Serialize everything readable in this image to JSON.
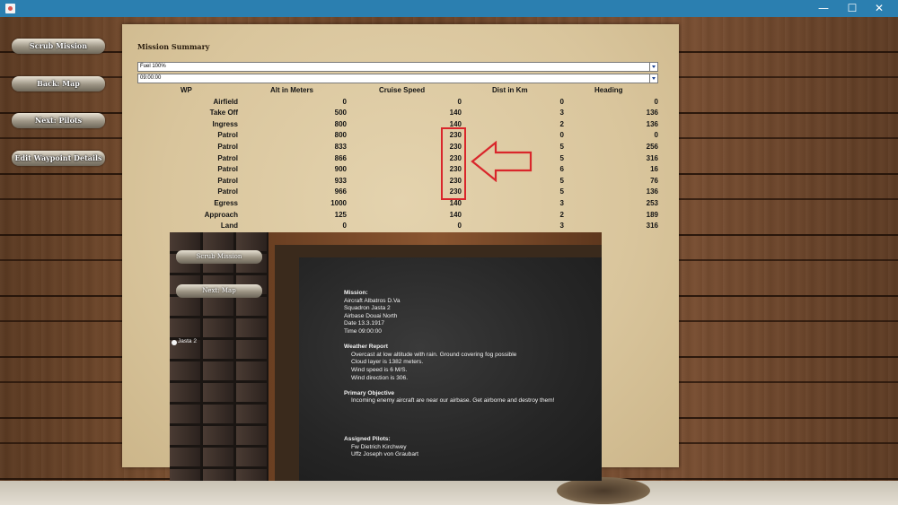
{
  "window": {
    "minimize": "—",
    "maximize": "☐",
    "close": "✕"
  },
  "menu": {
    "scrub_mission": "Scrub Mission",
    "back_map": "Back: Map",
    "next_pilots": "Next: Pilots",
    "edit_waypoint": "Edit Waypoint Details"
  },
  "summary": {
    "title": "Mission Summary",
    "fuel_select": "Fuel 100%",
    "time_select": "09:00:00",
    "columns": [
      "WP",
      "Alt in Meters",
      "Cruise Speed",
      "Dist in Km",
      "Heading"
    ],
    "rows": [
      [
        "Airfield",
        "0",
        "0",
        "0",
        "0"
      ],
      [
        "Take Off",
        "500",
        "140",
        "3",
        "136"
      ],
      [
        "Ingress",
        "800",
        "140",
        "2",
        "136"
      ],
      [
        "Patrol",
        "800",
        "230",
        "0",
        "0"
      ],
      [
        "Patrol",
        "833",
        "230",
        "5",
        "256"
      ],
      [
        "Patrol",
        "866",
        "230",
        "5",
        "316"
      ],
      [
        "Patrol",
        "900",
        "230",
        "6",
        "16"
      ],
      [
        "Patrol",
        "933",
        "230",
        "5",
        "76"
      ],
      [
        "Patrol",
        "966",
        "230",
        "5",
        "136"
      ],
      [
        "Egress",
        "1000",
        "140",
        "3",
        "253"
      ],
      [
        "Approach",
        "125",
        "140",
        "2",
        "189"
      ],
      [
        "Land",
        "0",
        "0",
        "3",
        "316"
      ]
    ]
  },
  "annotation_color": "#d9262b",
  "briefing": {
    "scrub_mission": "Scrub Mission",
    "next_map": "Next: Map",
    "squadron_option": "Jasta 2",
    "lines": [
      {
        "text": "Mission:",
        "cls": "head"
      },
      {
        "text": "Aircraft  Albatros D.Va",
        "cls": ""
      },
      {
        "text": "Squadron  Jasta 2",
        "cls": ""
      },
      {
        "text": "Airbase  Douai North",
        "cls": ""
      },
      {
        "text": "Date  13.3.1917",
        "cls": ""
      },
      {
        "text": "Time  09:00:00",
        "cls": ""
      },
      {
        "text": "",
        "cls": "gap"
      },
      {
        "text": "Weather Report",
        "cls": "head"
      },
      {
        "text": "Overcast at low altitude with rain.  Ground covering fog possible",
        "cls": "ind"
      },
      {
        "text": "Cloud layer is 1382 meters.",
        "cls": "ind2"
      },
      {
        "text": "Wind speed is 6 M/S.",
        "cls": "ind2"
      },
      {
        "text": "Wind direction is 306.",
        "cls": "ind2"
      },
      {
        "text": "",
        "cls": "gap"
      },
      {
        "text": "Primary Objective",
        "cls": "head"
      },
      {
        "text": "Incoming enemy aircraft are near our airbase.  Get airborne and destroy them!",
        "cls": "ind"
      },
      {
        "text": "",
        "cls": "gap"
      },
      {
        "text": "",
        "cls": "gap"
      },
      {
        "text": "",
        "cls": "gap"
      },
      {
        "text": "",
        "cls": "gap"
      },
      {
        "text": "Assigned Pilots:",
        "cls": "head"
      },
      {
        "text": "Fw Dietrich Kirchwey",
        "cls": "ind"
      },
      {
        "text": "Uffz Joseph von Graubart",
        "cls": "ind"
      }
    ]
  }
}
